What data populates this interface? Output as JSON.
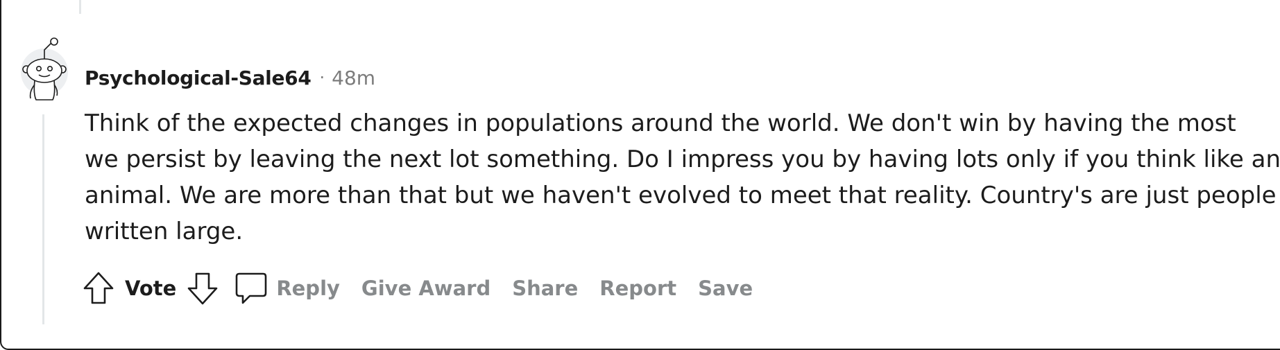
{
  "comment": {
    "username": "Psychological-Sale64",
    "separator": "·",
    "timestamp": "48m",
    "body_lines": [
      "Think of the expected changes in populations around the world. We don't win by having the most",
      "we persist by leaving the next lot something. Do I impress you by having lots only if you think like an",
      "animal. We are more than that but we haven't evolved to meet that reality. Country's are just people",
      "written large."
    ],
    "avatar_icon": "snoo-avatar-icon"
  },
  "actions": {
    "upvote_icon": "upvote-arrow-icon",
    "vote_label": "Vote",
    "downvote_icon": "downvote-arrow-icon",
    "reply_icon": "speech-bubble-icon",
    "reply_label": "Reply",
    "give_award_label": "Give Award",
    "share_label": "Share",
    "report_label": "Report",
    "save_label": "Save"
  },
  "colors": {
    "text_primary": "#1c1c1c",
    "text_muted": "#7c7c7c",
    "action_gray": "#878a8c",
    "thread_line": "#e3e6e8"
  }
}
